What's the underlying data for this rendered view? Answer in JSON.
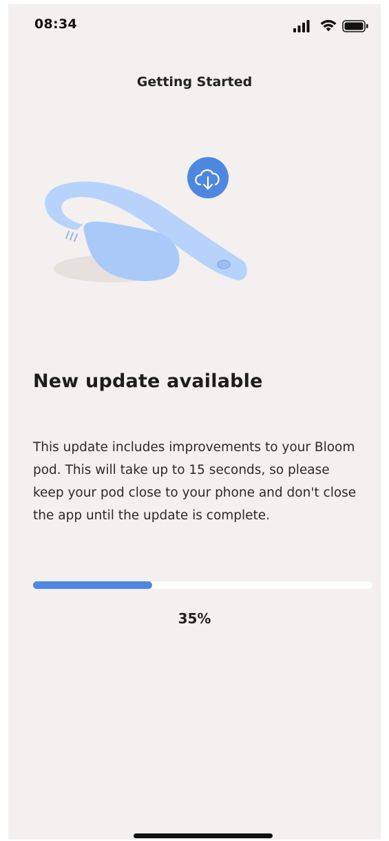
{
  "status_bar": {
    "time": "08:34",
    "icons": [
      "cellular-signal-icon",
      "wifi-icon",
      "battery-icon"
    ]
  },
  "header": {
    "title": "Getting Started"
  },
  "illustration": {
    "badge_icon": "cloud-download-icon",
    "colors": {
      "device": "#b7d3fb",
      "device_shade": "#a5c6f6",
      "badge": "#4e87e0",
      "shadow": "#e6e1dc"
    }
  },
  "content": {
    "headline": "New update available",
    "body": "This update includes improvements to your Bloom pod. This will take up to 15 seconds, so please keep your pod close to your phone and don't close the app until the update is complete."
  },
  "progress": {
    "value": 0.35,
    "label": "35%"
  },
  "colors": {
    "background": "#f3f0ef",
    "accent": "#4e87e0",
    "track": "#ffffff"
  }
}
